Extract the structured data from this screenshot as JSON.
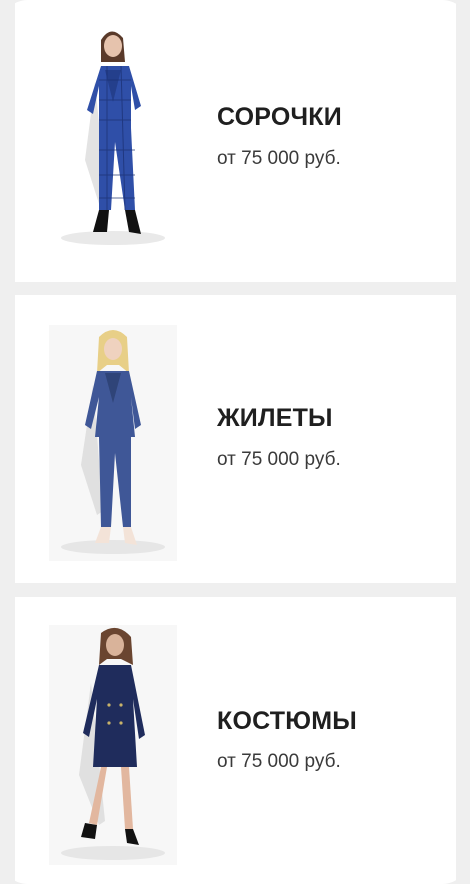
{
  "products": [
    {
      "title": "СОРОЧКИ",
      "price": "от 75 000 руб.",
      "image": "model-blue-check-pantsuit-photo",
      "garment_color": "#2f4fa8"
    },
    {
      "title": "ЖИЛЕТЫ",
      "price": "от 75 000 руб.",
      "image": "model-blue-pantsuit-photo",
      "garment_color": "#3f5797"
    },
    {
      "title": "КОСТЮМЫ",
      "price": "от 75 000 руб.",
      "image": "model-navy-coat-dress-photo",
      "garment_color": "#1f2c5c"
    }
  ]
}
